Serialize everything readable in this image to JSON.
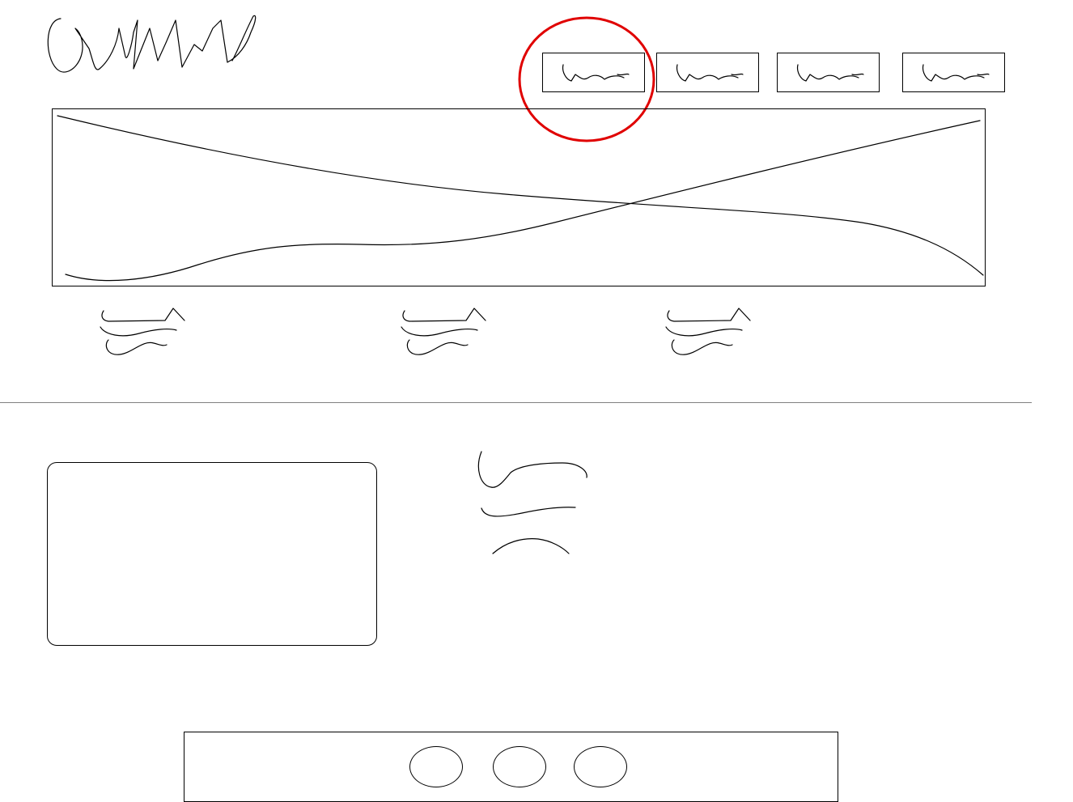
{
  "colors": {
    "ink": "#000000",
    "divider": "#808080",
    "highlight": "#e00000",
    "background": "#ffffff"
  },
  "header": {
    "logo": "logo-scribble",
    "nav_items": [
      {
        "label": "",
        "icon": "scribble-label"
      },
      {
        "label": "",
        "icon": "scribble-label"
      },
      {
        "label": "",
        "icon": "scribble-label"
      },
      {
        "label": "",
        "icon": "scribble-label"
      }
    ],
    "highlighted_nav_index": 0
  },
  "hero": {
    "image": "placeholder-image-cross"
  },
  "features": {
    "items": [
      {
        "heading": "",
        "text": ""
      },
      {
        "heading": "",
        "text": ""
      },
      {
        "heading": "",
        "text": ""
      }
    ]
  },
  "content": {
    "image_box": "placeholder-image",
    "text_block": {
      "title": "",
      "lines": [
        "",
        ""
      ]
    }
  },
  "footer": {
    "buttons": [
      {
        "label": "",
        "icon": "circle"
      },
      {
        "label": "",
        "icon": "circle"
      },
      {
        "label": "",
        "icon": "circle"
      }
    ]
  }
}
